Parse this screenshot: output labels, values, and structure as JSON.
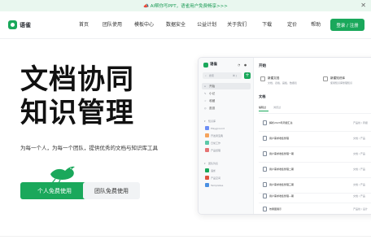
{
  "banner": {
    "text": "📣 AI帮你写PPT，语雀用户免费畅享>>>",
    "close_icon": "close-icon"
  },
  "brand": {
    "name": "语雀",
    "color": "#1aa85b"
  },
  "nav": {
    "items": [
      "首页",
      "团队使用",
      "模板中心",
      "数据安全",
      "公益计划",
      "关于我们",
      "下载",
      "定价",
      "帮助"
    ],
    "login_label": "登录 / 注册"
  },
  "hero": {
    "title_line1": "文档协同",
    "title_line2": "知识管理",
    "subtitle": "为每一个人，为每一个团队，提供优秀的文档与知识库工具",
    "personal_button": "个人免费使用",
    "team_button": "团队免费使用"
  },
  "app_preview": {
    "sidebar": {
      "brand": "语雀",
      "search_placeholder": "搜索",
      "search_shortcut": "⌘ J",
      "plus_label": "+",
      "nav_items": [
        "开始",
        "小记",
        "收藏",
        "逛逛"
      ],
      "kb_section": "知识库",
      "knowledge_bases": [
        "Playground",
        "开发者宝典",
        "日常工作",
        "产品经理"
      ],
      "team_section": "团队列表",
      "teams": [
        "语雀",
        "产品空间",
        "Templates"
      ]
    },
    "main": {
      "heading": "开始",
      "new_doc_title": "新建文档",
      "new_doc_desc": "文档、表格、画板、数据表",
      "new_kb_title": "新建知识库",
      "new_kb_desc": "使用知识库整理知识",
      "docs_heading": "文档",
      "tabs": [
        "编辑过",
        "浏览过"
      ],
      "documents": [
        {
          "title": "解析2023年周报汇总",
          "meta": "产品线 / 周报"
        },
        {
          "title": "用户需求收集整理",
          "meta": "文档 / 产品"
        },
        {
          "title": "用户需求收集整理一期",
          "meta": "文档 / 产品"
        },
        {
          "title": "用户需求收集整理二期",
          "meta": "文档 / 产品"
        },
        {
          "title": "用户需求收集整理三期",
          "meta": "文档 / 产品"
        },
        {
          "title": "用户需求收集整理—期",
          "meta": "文档 / 产品"
        },
        {
          "title": "效果图展示",
          "meta": "产品线 / 设计"
        }
      ]
    }
  },
  "colors": {
    "accent": "#1aa85b",
    "banner_bg": "#e9f7ef"
  }
}
